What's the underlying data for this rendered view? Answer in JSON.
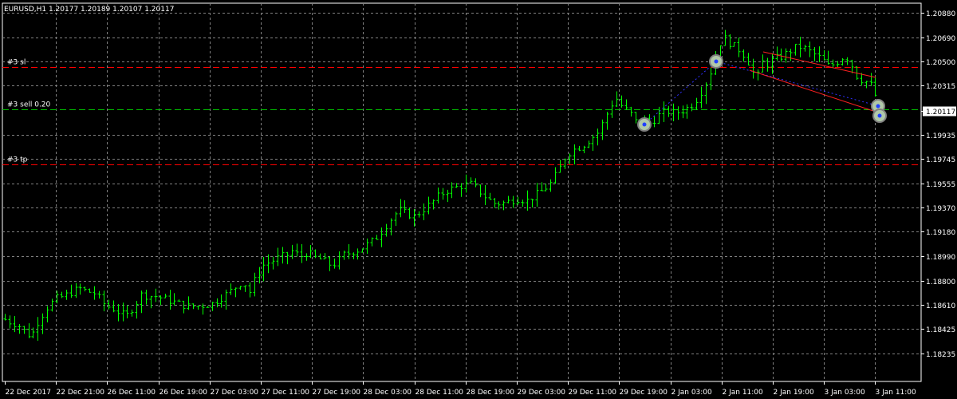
{
  "chart_data": {
    "type": "ohlc",
    "symbol_label": "EURUSD,H1  1.20177 1.20189 1.20107 1.20117",
    "timeframe": "H1",
    "last_price_label": "1.20117",
    "last_price": 1.20117,
    "y_axis_labels": [
      "1.20880",
      "1.20690",
      "1.20500",
      "1.20315",
      "1.20117",
      "1.19935",
      "1.19745",
      "1.19555",
      "1.19370",
      "1.19180",
      "1.18990",
      "1.18800",
      "1.18610",
      "1.18425",
      "1.18235"
    ],
    "ylim": [
      1.18235,
      1.2088
    ],
    "x_axis_labels": [
      "22 Dec 2017",
      "22 Dec 21:00",
      "26 Dec 11:00",
      "26 Dec 19:00",
      "27 Dec 03:00",
      "27 Dec 11:00",
      "27 Dec 19:00",
      "28 Dec 03:00",
      "28 Dec 11:00",
      "28 Dec 19:00",
      "29 Dec 03:00",
      "29 Dec 11:00",
      "29 Dec 19:00",
      "2 Jan 03:00",
      "2 Jan 11:00",
      "2 Jan 19:00",
      "3 Jan 03:00",
      "3 Jan 11:00"
    ],
    "grid": true,
    "price_lines": [
      {
        "label": "#3 sl",
        "price": 1.2046,
        "color": "#ff0000",
        "style": "dashed"
      },
      {
        "label": "#3 sell 0.20",
        "price": 1.2013,
        "color": "#00c000",
        "style": "dashed"
      },
      {
        "label": "#3 tp",
        "price": 1.19705,
        "color": "#ff0000",
        "style": "dashed"
      }
    ],
    "bar_color": "#00ff00",
    "grid_color": "#808080",
    "background": "#000000",
    "path_points": [
      [
        0,
        1.1852
      ],
      [
        12,
        1.1848
      ],
      [
        22,
        1.1846
      ],
      [
        35,
        1.1838
      ],
      [
        42,
        1.184
      ],
      [
        48,
        1.1849
      ],
      [
        60,
        1.186
      ],
      [
        70,
        1.1866
      ],
      [
        80,
        1.1868
      ],
      [
        92,
        1.1872
      ],
      [
        100,
        1.1874
      ],
      [
        108,
        1.1872
      ],
      [
        120,
        1.187
      ],
      [
        128,
        1.1863
      ],
      [
        135,
        1.186
      ],
      [
        142,
        1.1858
      ],
      [
        150,
        1.1855
      ],
      [
        158,
        1.1852
      ],
      [
        165,
        1.1858
      ],
      [
        172,
        1.1864
      ],
      [
        178,
        1.187
      ],
      [
        185,
        1.1868
      ],
      [
        195,
        1.1868
      ],
      [
        205,
        1.1866
      ],
      [
        215,
        1.1864
      ],
      [
        225,
        1.1862
      ],
      [
        235,
        1.186
      ],
      [
        245,
        1.186
      ],
      [
        255,
        1.1861
      ],
      [
        265,
        1.1862
      ],
      [
        275,
        1.1866
      ],
      [
        285,
        1.187
      ],
      [
        295,
        1.1875
      ],
      [
        305,
        1.188
      ],
      [
        312,
        1.187
      ],
      [
        320,
        1.1882
      ],
      [
        330,
        1.1892
      ],
      [
        340,
        1.1895
      ],
      [
        350,
        1.1898
      ],
      [
        360,
        1.19
      ],
      [
        368,
        1.1904
      ],
      [
        375,
        1.1898
      ],
      [
        385,
        1.1902
      ],
      [
        395,
        1.1898
      ],
      [
        405,
        1.1896
      ],
      [
        415,
        1.1892
      ],
      [
        422,
        1.1894
      ],
      [
        430,
        1.19
      ],
      [
        440,
        1.1902
      ],
      [
        450,
        1.1904
      ],
      [
        460,
        1.1908
      ],
      [
        470,
        1.1912
      ],
      [
        480,
        1.192
      ],
      [
        490,
        1.1928
      ],
      [
        500,
        1.1935
      ],
      [
        510,
        1.1932
      ],
      [
        520,
        1.193
      ],
      [
        530,
        1.1935
      ],
      [
        540,
        1.194
      ],
      [
        550,
        1.1946
      ],
      [
        560,
        1.195
      ],
      [
        570,
        1.1952
      ],
      [
        580,
        1.1954
      ],
      [
        590,
        1.1955
      ],
      [
        600,
        1.195
      ],
      [
        610,
        1.1944
      ],
      [
        620,
        1.194
      ],
      [
        630,
        1.194
      ],
      [
        640,
        1.1942
      ],
      [
        650,
        1.1944
      ],
      [
        660,
        1.1942
      ],
      [
        670,
        1.1946
      ],
      [
        680,
        1.195
      ],
      [
        690,
        1.1955
      ],
      [
        700,
        1.1965
      ],
      [
        710,
        1.1978
      ],
      [
        720,
        1.1982
      ],
      [
        730,
        1.1985
      ],
      [
        740,
        1.199
      ],
      [
        750,
        1.1995
      ],
      [
        758,
        1.2005
      ],
      [
        765,
        1.2015
      ],
      [
        772,
        1.2022
      ],
      [
        780,
        1.2015
      ],
      [
        790,
        1.201
      ],
      [
        800,
        1.2
      ],
      [
        808,
        1.2005
      ],
      [
        815,
        1.2002
      ],
      [
        825,
        1.2008
      ],
      [
        835,
        1.2012
      ],
      [
        845,
        1.201
      ],
      [
        855,
        1.2012
      ],
      [
        865,
        1.2015
      ],
      [
        875,
        1.2022
      ],
      [
        882,
        1.203
      ],
      [
        890,
        1.204
      ],
      [
        895,
        1.205
      ],
      [
        900,
        1.2058
      ],
      [
        905,
        1.207
      ],
      [
        912,
        1.2066
      ],
      [
        920,
        1.2062
      ],
      [
        930,
        1.2058
      ],
      [
        940,
        1.2048
      ],
      [
        948,
        1.2035
      ],
      [
        955,
        1.205
      ],
      [
        962,
        1.2048
      ],
      [
        970,
        1.2052
      ],
      [
        980,
        1.2054
      ],
      [
        990,
        1.2058
      ],
      [
        1000,
        1.2062
      ],
      [
        1010,
        1.206
      ],
      [
        1020,
        1.2056
      ],
      [
        1030,
        1.2052
      ],
      [
        1040,
        1.2046
      ],
      [
        1050,
        1.205
      ],
      [
        1058,
        1.2054
      ],
      [
        1065,
        1.2052
      ],
      [
        1072,
        1.204
      ],
      [
        1080,
        1.2036
      ],
      [
        1088,
        1.2034
      ],
      [
        1095,
        1.203
      ],
      [
        1100,
        1.2018
      ],
      [
        1104,
        1.2012
      ]
    ]
  }
}
